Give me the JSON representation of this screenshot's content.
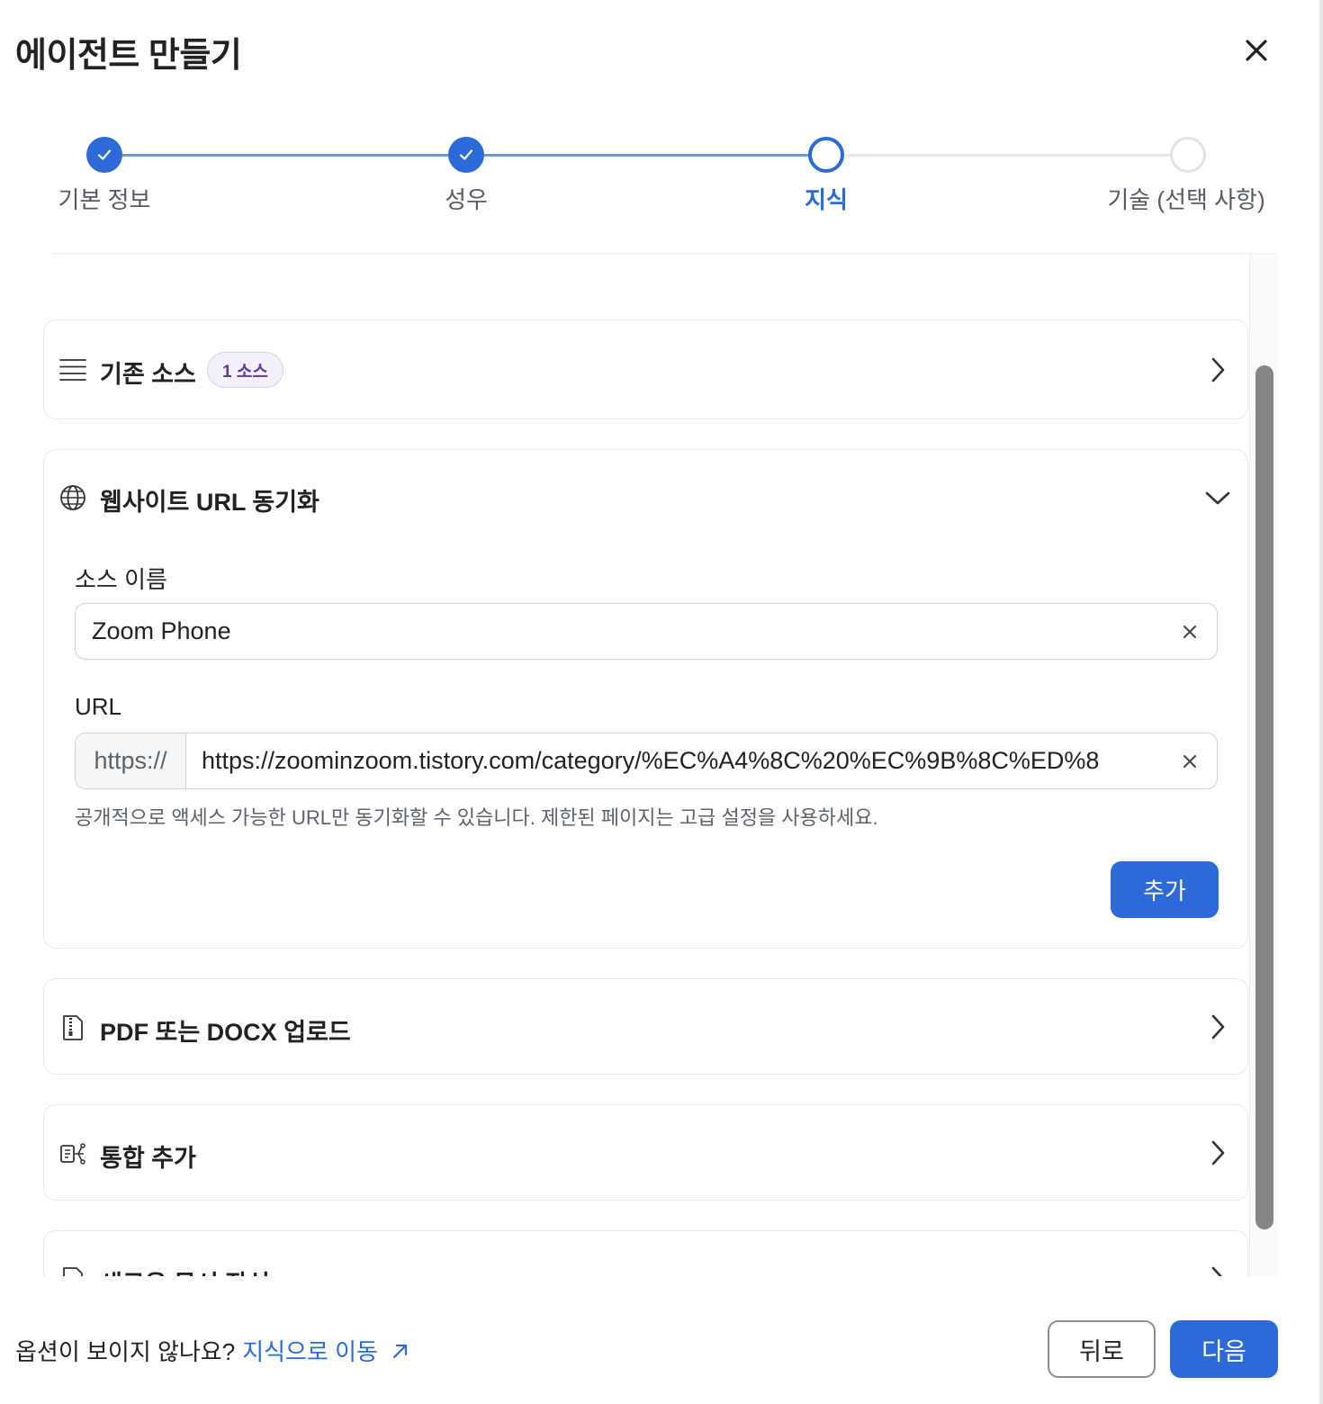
{
  "header": {
    "title": "에이전트 만들기"
  },
  "stepper": {
    "steps": [
      {
        "label": "기본 정보",
        "state": "done"
      },
      {
        "label": "성우",
        "state": "done"
      },
      {
        "label": "지식",
        "state": "current"
      },
      {
        "label": "기술 (선택 사항)",
        "state": "todo"
      }
    ]
  },
  "sections": {
    "existing": {
      "title": "기존 소스",
      "badge": "1 소스"
    },
    "website": {
      "title": "웹사이트 URL 동기화",
      "source_name_label": "소스 이름",
      "source_name_value": "Zoom Phone",
      "url_label": "URL",
      "url_prefix": "https://",
      "url_value": "https://zoominzoom.tistory.com/category/%EC%A4%8C%20%EC%9B%8C%ED%8",
      "hint": "공개적으로 액세스 가능한 URL만 동기화할 수 있습니다. 제한된 페이지는 고급 설정을 사용하세요.",
      "add_label": "추가"
    },
    "upload": {
      "title": "PDF 또는 DOCX 업로드"
    },
    "integration": {
      "title": "통합 추가"
    },
    "new_doc": {
      "title": "새로운 문서 작성"
    }
  },
  "footer": {
    "question": "옵션이 보이지 않나요?",
    "link": "지식으로 이동",
    "back_label": "뒤로",
    "next_label": "다음"
  },
  "colors": {
    "accent": "#2b6ad8",
    "badge_bg": "#f4f0fb",
    "badge_text": "#5b3c99"
  },
  "icons": [
    "close-icon",
    "check-icon",
    "list-icon",
    "globe-icon",
    "chevron-right-icon",
    "chevron-down-icon",
    "file-zip-icon",
    "integration-icon",
    "document-icon",
    "external-link-icon"
  ]
}
